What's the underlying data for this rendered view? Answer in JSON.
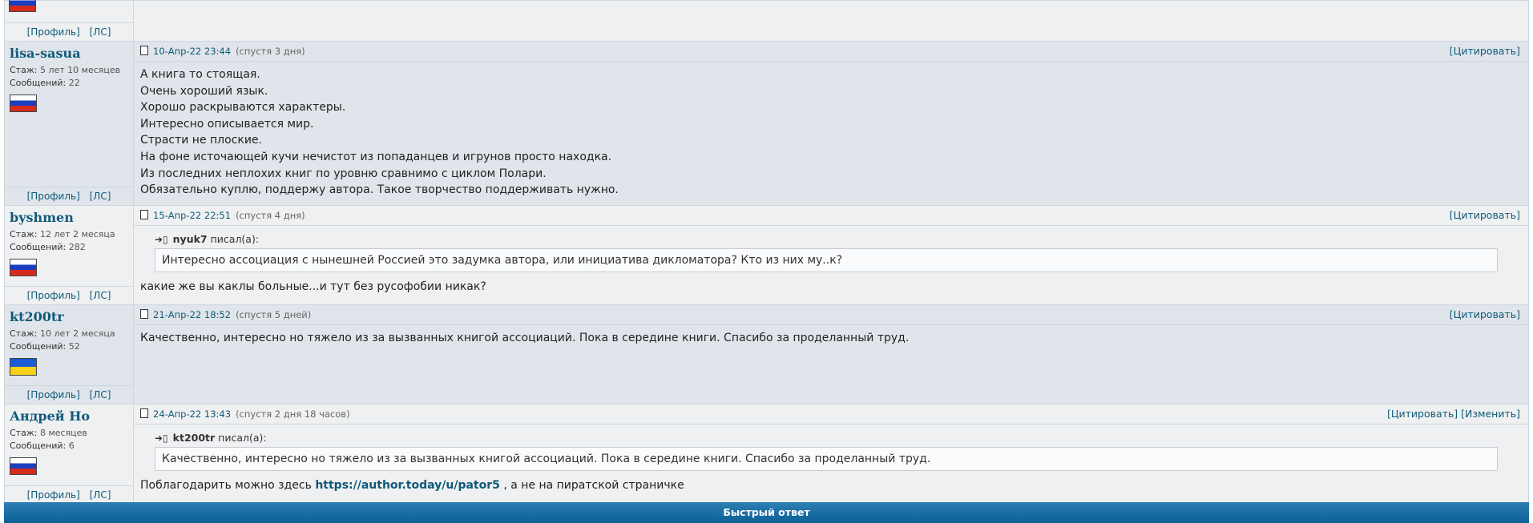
{
  "user_actions": {
    "profile": "[Профиль]",
    "pm": "[ЛС]"
  },
  "labels": {
    "stazh": "Стаж:",
    "posts": "Сообщений:",
    "wrote": "писал(а):"
  },
  "post_actions": {
    "quote": "[Цитировать]",
    "edit": "[Изменить]"
  },
  "posts": [
    {
      "author": "lisa-sasua",
      "stazh": "5 лет 10 месяцев",
      "posts": "22",
      "flag": "ru",
      "date": "10-Апр-22 23:44",
      "ago": "(спустя 3 дня)",
      "lines": [
        "А книга то стоящая.",
        "Очень хороший язык.",
        "Хорошо раскрываются характеры.",
        "Интересно описывается мир.",
        "Страсти не плоские.",
        "На фоне источающей кучи нечистот из попаданцев и игрунов просто находка.",
        "Из последних неплохих книг по уровню сравнимо с циклом Полари.",
        "Обязательно куплю, поддержу автора. Такое творчество поддерживать нужно."
      ]
    },
    {
      "author": "byshmen",
      "stazh": "12 лет 2 месяца",
      "posts": "282",
      "flag": "ru",
      "date": "15-Апр-22 22:51",
      "ago": "(спустя 4 дня)",
      "quote_author": "nyuk7",
      "quote_text": "Интересно ассоциация с нынешней Россией это задумка автора, или инициатива дикломатора? Кто из них му..к?",
      "text": "какие же вы каклы больные...и тут без русофобии никак?"
    },
    {
      "author": "kt200tr",
      "stazh": "10 лет 2 месяца",
      "posts": "52",
      "flag": "ua",
      "date": "21-Апр-22 18:52",
      "ago": "(спустя 5 дней)",
      "text": "Качественно, интересно но тяжело из за вызванных книгой ассоциаций. Пока в середине книги. Спасибо за проделанный труд."
    },
    {
      "author": "Андрей Но",
      "stazh": "8 месяцев",
      "posts": "6",
      "flag": "ru",
      "date": "24-Апр-22 13:43",
      "ago": "(спустя 2 дня 18 часов)",
      "quote_author": "kt200tr",
      "quote_text": "Качественно, интересно но тяжело из за вызванных книгой ассоциаций. Пока в середине книги. Спасибо за проделанный труд.",
      "text_before": "Поблагодарить можно здесь",
      "link": "https://author.today/u/pator5",
      "text_after": ", а не на пиратской страничке"
    }
  ],
  "quick_reply": "Быстрый ответ"
}
